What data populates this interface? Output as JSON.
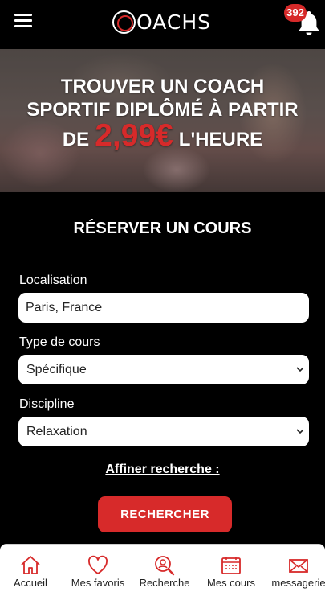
{
  "header": {
    "logo_text": "OACHS",
    "notification_count": "392"
  },
  "hero": {
    "line1": "TROUVER UN COACH",
    "line2": "SPORTIF DIPLÔMÉ À PARTIR",
    "line3_prefix": "DE",
    "price": "2,99€",
    "line3_suffix": "L'HEURE"
  },
  "form": {
    "title": "RÉSERVER UN COURS",
    "location_label": "Localisation",
    "location_value": "Paris, France",
    "course_type_label": "Type de cours",
    "course_type_value": "Spécifique",
    "discipline_label": "Discipline",
    "discipline_value": "Relaxation",
    "refine_label": "Affiner recherche :",
    "search_label": "RECHERCHER"
  },
  "tabs": [
    {
      "label": "Accueil",
      "icon": "home-icon"
    },
    {
      "label": "Mes favoris",
      "icon": "heart-icon"
    },
    {
      "label": "Recherche",
      "icon": "search-coach-icon"
    },
    {
      "label": "Mes cours",
      "icon": "calendar-icon"
    },
    {
      "label": "messagerie",
      "icon": "envelope-icon"
    }
  ],
  "colors": {
    "accent": "#d72a2a",
    "background": "#000000",
    "tabbar": "#ffffff"
  }
}
